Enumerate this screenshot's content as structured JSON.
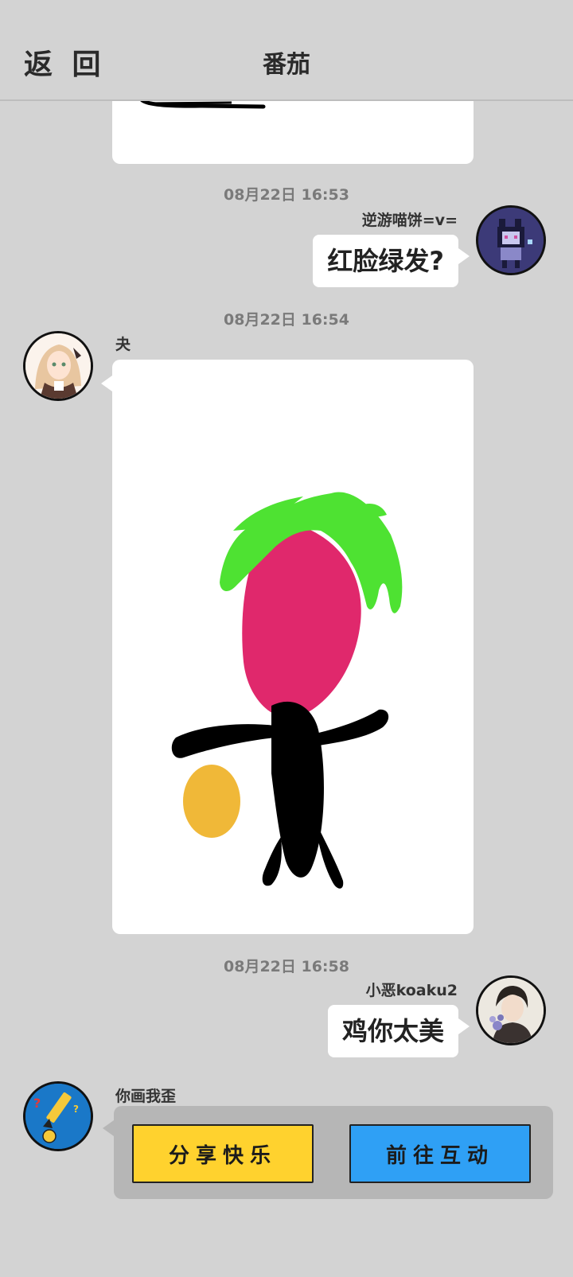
{
  "header": {
    "back_label": "返 回",
    "title": "番茄"
  },
  "messages": [
    {
      "time": "08月22日  16:53",
      "sender": "逆游喵饼=v=",
      "text": "红脸绿发?"
    },
    {
      "time": "08月22日  16:54",
      "sender": "夬"
    },
    {
      "time": "08月22日  16:58",
      "sender": "小恶koaku2",
      "text": "鸡你太美"
    },
    {
      "sender": "你画我歪",
      "buttons": {
        "share": "分享快乐",
        "interact": "前往互动"
      }
    }
  ],
  "colors": {
    "background": "#d3d3d3",
    "leaf_green": "#4ee232",
    "radish_pink": "#e0286c",
    "ink_black": "#000000",
    "ball_yellow": "#f0b838",
    "share_yellow": "#ffd22e",
    "interact_blue": "#2fa0f5"
  }
}
